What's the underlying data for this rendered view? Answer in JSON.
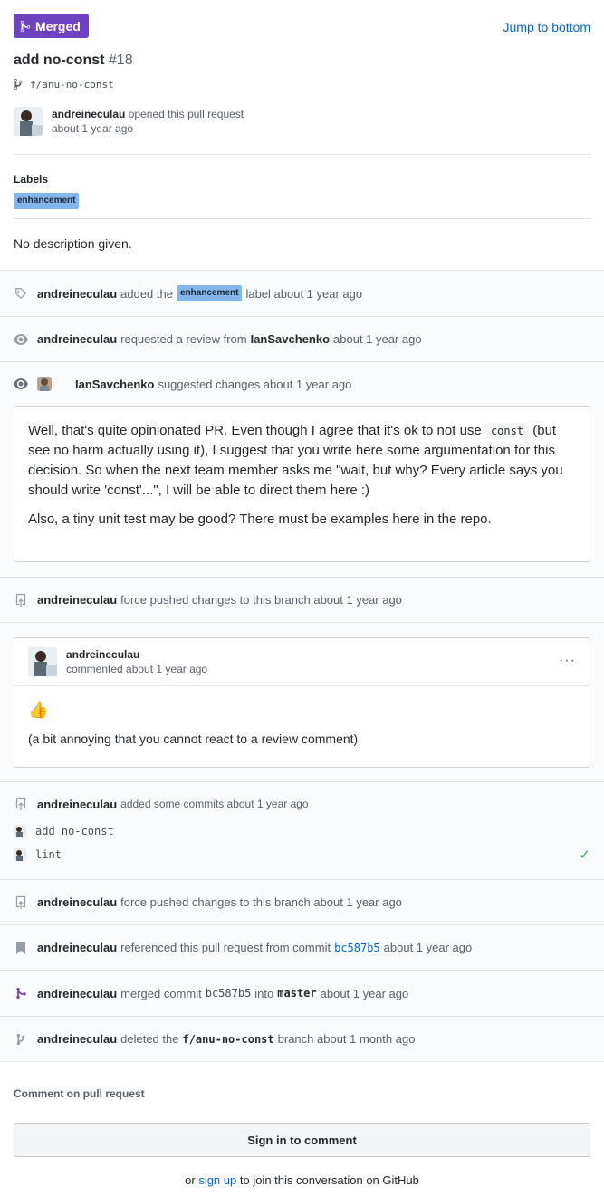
{
  "header": {
    "state": "Merged",
    "jump_link": "Jump to bottom",
    "title": "add no-const",
    "number": "#18",
    "branch": "f/anu-no-const",
    "author": "andreineculau",
    "opened_text": "opened this pull request",
    "opened_time": "about 1 year ago"
  },
  "labels_section": {
    "heading": "Labels",
    "label": "enhancement"
  },
  "description": "No description given.",
  "timeline": {
    "labeled": {
      "actor": "andreineculau",
      "pre": "added the",
      "label": "enhancement",
      "post": "label about 1 year ago"
    },
    "review_requested": {
      "actor": "andreineculau",
      "pre": "requested a review from",
      "reviewer": "IanSavchenko",
      "post": "about 1 year ago"
    },
    "review": {
      "actor": "IanSavchenko",
      "text": "suggested changes about 1 year ago",
      "body_p1_a": "Well, that's quite opinionated PR. Even though I agree that it's ok to not use",
      "body_code": "const",
      "body_p1_b": "(but see no harm actually using it), I suggest that you write here some argumentation for this decision. So when the next team member asks me \"wait, but why? Every article says you should write 'const'...\", I will be able to direct them here :)",
      "body_p2": "Also, a tiny unit test may be good? There must be examples here in the repo."
    },
    "force_push_1": {
      "actor": "andreineculau",
      "text": "force pushed changes to this branch about 1 year ago"
    },
    "comment": {
      "author": "andreineculau",
      "time": "commented about 1 year ago",
      "more": "···",
      "emoji": "👍",
      "body": "(a bit annoying that you cannot react to a review comment)"
    },
    "commits": {
      "actor": "andreineculau",
      "text": "added some commits about 1 year ago",
      "items": [
        "add no-const",
        "lint"
      ],
      "check": "✓"
    },
    "force_push_2": {
      "actor": "andreineculau",
      "text": "force pushed changes to this branch about 1 year ago"
    },
    "referenced": {
      "actor": "andreineculau",
      "pre": "referenced this pull request from commit",
      "commit": "bc587b5",
      "post": "about 1 year ago"
    },
    "merged": {
      "actor": "andreineculau",
      "pre": "merged commit",
      "commit": "bc587b5",
      "mid": "into",
      "branch": "master",
      "post": "about 1 year ago"
    },
    "deleted": {
      "actor": "andreineculau",
      "pre": "deleted the",
      "branch": "f/anu-no-const",
      "post": "branch about 1 month ago"
    }
  },
  "footer": {
    "heading": "Comment on pull request",
    "signin": "Sign in to comment",
    "join_pre": "or",
    "join_link": "sign up",
    "join_post": "to join this conversation on GitHub"
  },
  "colors": {
    "merged": "#6f42c1",
    "label": "#84b6eb",
    "link": "#0366d6",
    "success": "#28a745"
  }
}
